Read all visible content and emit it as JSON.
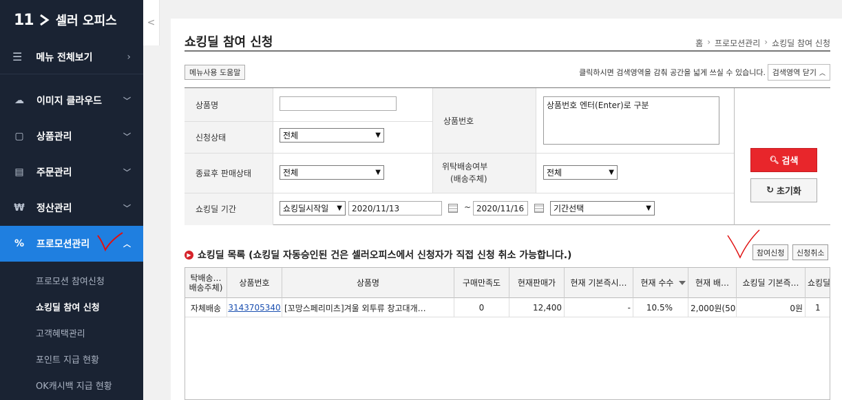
{
  "sidebar": {
    "logo_mark": "11",
    "logo_text": "셀러 오피스",
    "collapse_glyph": "<",
    "menu_all": "메뉴 전체보기",
    "items": [
      {
        "label": "이미지 클라우드",
        "icon": "cloud-icon"
      },
      {
        "label": "상품관리",
        "icon": "product-icon"
      },
      {
        "label": "주문관리",
        "icon": "order-icon"
      },
      {
        "label": "정산관리",
        "icon": "won-icon"
      },
      {
        "label": "프로모션관리",
        "icon": "percent-icon",
        "active": true
      }
    ],
    "submenu": [
      {
        "label": "프로모션 참여신청"
      },
      {
        "label": "쇼킹딜 참여 신청",
        "current": true
      },
      {
        "label": "고객혜택관리"
      },
      {
        "label": "포인트 지급 현황"
      },
      {
        "label": "OK캐시백 지급 현황"
      }
    ]
  },
  "header": {
    "title": "쇼킹딜 참여 신청",
    "breadcrumb": [
      "홈",
      "프로모션관리",
      "쇼킹딜 참여 신청"
    ]
  },
  "toolbar": {
    "help_label": "메뉴사용 도움말",
    "hint": "클릭하시면 검색영역을 감춰 공간을 넓게 쓰실 수 있습니다.",
    "close_search_label": "검색영역 닫기"
  },
  "form": {
    "product_name_label": "상품명",
    "product_name_value": "",
    "status_label": "신청상태",
    "status_value": "전체",
    "product_no_label": "상품번호",
    "product_no_value": "상품번호 엔터(Enter)로 구분",
    "after_sale_label": "종료후 판매상태",
    "after_sale_value": "전체",
    "consign_label_1": "위탁배송여부",
    "consign_label_2": "(배송주체)",
    "consign_value": "전체",
    "period_label": "쇼킹딜 기간",
    "period_type_value": "쇼킹딜시작일",
    "date_from": "2020/11/13",
    "date_sep": "~",
    "date_to": "2020/11/16",
    "period_select_value": "기간선택",
    "search_button": "검색",
    "reset_button": "초기화"
  },
  "list": {
    "title": "쇼킹딜 목록 (쇼킹딜 자동승인된 건은 셀러오피스에서 신청자가 직접 신청 취소 가능합니다.)",
    "apply_button": "참여신청",
    "cancel_button": "신청취소",
    "columns": [
      {
        "label": "탁배송…\n배송주체)"
      },
      {
        "label": "상품번호"
      },
      {
        "label": "상품명"
      },
      {
        "label": "구매만족도"
      },
      {
        "label": "현재판매가"
      },
      {
        "label": "현재 기본즉시…"
      },
      {
        "label": "현재 수수"
      },
      {
        "label": "현재 배…"
      },
      {
        "label": "쇼킹딜 기본즉…"
      },
      {
        "label": "쇼킹딜"
      }
    ],
    "rows": [
      {
        "cells": [
          "자체배송",
          "3143705340",
          "[꼬망스페리미츠]겨울 외투류 창고대개…",
          "0",
          "12,400",
          "-",
          "10.5%",
          "2,000원(50…",
          "0원",
          "1"
        ]
      }
    ]
  },
  "colors": {
    "sidebar_bg": "#1a2333",
    "active_blue": "#1f7fe0",
    "search_red": "#e8262b",
    "annotation_red": "#e01010"
  }
}
